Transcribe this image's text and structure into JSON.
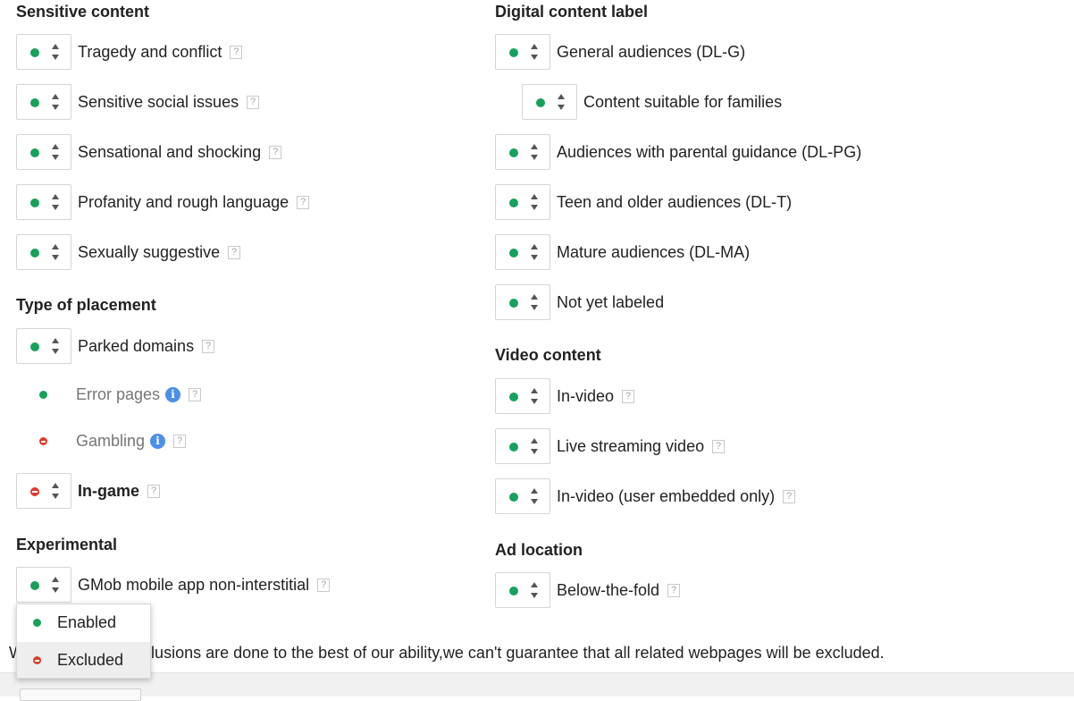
{
  "colors": {
    "enabled_dot": "#18a15a",
    "excluded_dot": "#dd3a2c",
    "info_icon": "#4a8fe8"
  },
  "help_glyph": "?",
  "info_glyph": "i",
  "sections": {
    "sensitive_content": {
      "title": "Sensitive content",
      "items": [
        {
          "label": "Tragedy and conflict",
          "status": "enabled"
        },
        {
          "label": "Sensitive social issues",
          "status": "enabled"
        },
        {
          "label": "Sensational and shocking",
          "status": "enabled"
        },
        {
          "label": "Profanity and rough language",
          "status": "enabled"
        },
        {
          "label": "Sexually suggestive",
          "status": "enabled"
        }
      ]
    },
    "type_of_placement": {
      "title": "Type of placement",
      "items": [
        {
          "label": "Parked domains",
          "status": "enabled"
        },
        {
          "label": "Error pages",
          "status": "enabled"
        },
        {
          "label": "Gambling",
          "status": "excluded"
        },
        {
          "label": "In-game",
          "status": "excluded"
        }
      ]
    },
    "experimental": {
      "title": "Experimental",
      "items": [
        {
          "label": "GMob mobile app non-interstitial",
          "status": "enabled"
        }
      ]
    },
    "digital_content_label": {
      "title": "Digital content label",
      "items": [
        {
          "label": "General audiences (DL-G)",
          "status": "enabled"
        },
        {
          "label": "Content suitable for families",
          "status": "enabled"
        },
        {
          "label": "Audiences with parental guidance (DL-PG)",
          "status": "enabled"
        },
        {
          "label": "Teen and older audiences (DL-T)",
          "status": "enabled"
        },
        {
          "label": "Mature audiences (DL-MA)",
          "status": "enabled"
        },
        {
          "label": "Not yet labeled",
          "status": "enabled"
        }
      ]
    },
    "video_content": {
      "title": "Video content",
      "items": [
        {
          "label": "In-video",
          "status": "enabled"
        },
        {
          "label": "Live streaming video",
          "status": "enabled"
        },
        {
          "label": "In-video (user embedded only)",
          "status": "enabled"
        }
      ]
    },
    "ad_location": {
      "title": "Ad location",
      "items": [
        {
          "label": "Below-the-fold",
          "status": "enabled"
        }
      ]
    }
  },
  "dropdown": {
    "options": [
      {
        "label": "Enabled",
        "status": "enabled"
      },
      {
        "label": "Excluded",
        "status": "excluded"
      }
    ],
    "highlighted": "Excluded"
  },
  "footer_note": "W          ge type exclusions are done to the best of our ability,we can't guarantee that all related webpages will be excluded."
}
